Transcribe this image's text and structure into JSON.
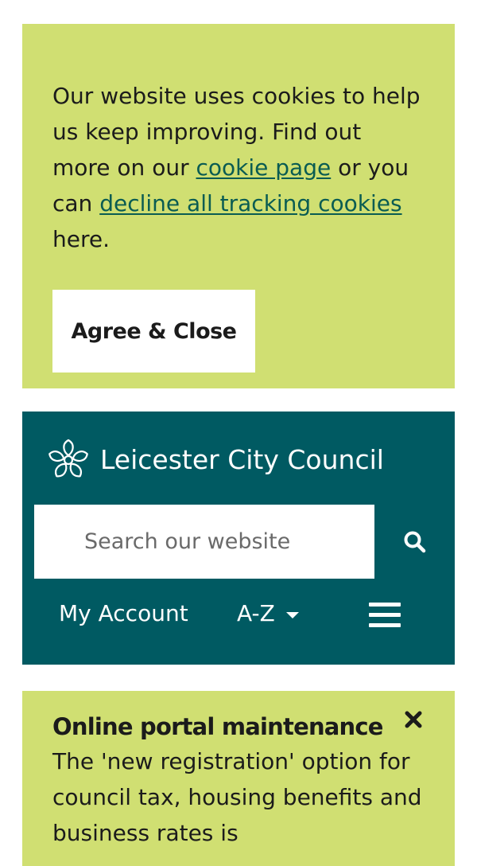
{
  "cookie_banner": {
    "text_before": "Our website uses cookies to help us keep improving. Find out more on our ",
    "cookie_page_link": "cookie page",
    "text_middle": " or you can ",
    "decline_link": "decline all tracking cookies",
    "text_after": " here.",
    "agree_button": "Agree & Close"
  },
  "header": {
    "brand_name": "Leicester City Council",
    "search_placeholder": "Search our website",
    "nav": {
      "my_account": "My Account",
      "az": "A-Z"
    }
  },
  "alert": {
    "title": "Online portal maintenance",
    "body": "The 'new registration' option for council tax, housing benefits and business rates is"
  },
  "colors": {
    "banner_green": "#d0df72",
    "header_teal": "#005a62",
    "link_teal": "#0a5c52"
  },
  "icons": [
    "flower-logo-icon",
    "search-icon",
    "caret-down-icon",
    "hamburger-menu-icon",
    "close-icon"
  ]
}
